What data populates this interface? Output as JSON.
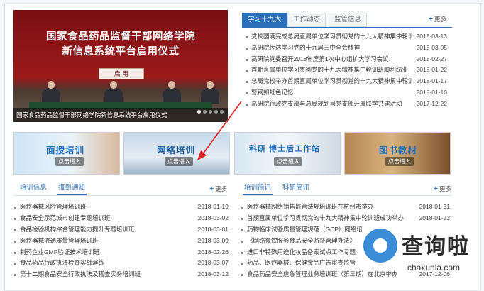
{
  "hero": {
    "title_line1": "国家食品药品监督干部网络学院",
    "title_line2": "新信息系统平台启用仪式",
    "plaque": "启 用",
    "caption": "国家食品药品监督干部网络学院新信息系统平台启用仪式"
  },
  "news": {
    "tabs": [
      "学习十九大",
      "工作动态",
      "监管信息"
    ],
    "more": "更多",
    "items": [
      {
        "title": "党校圆满完成总局直属单位学习贯彻党的十九大精神集中轮训",
        "date": "2018-03-13"
      },
      {
        "title": "高研院传达学习党的十九届三中全会精神",
        "date": "2018-03-05"
      },
      {
        "title": "高研院党委召开2018年度第1次中心组扩大学习会议",
        "date": "2018-02-27"
      },
      {
        "title": "首期直属单位学习贯彻党的十九大精神集中轮训班顺利结业",
        "date": "2018-01-22"
      },
      {
        "title": "总局党校举办首期直属单位学习贯彻党的十九大精神集中轮训",
        "date": "2018-01-17"
      },
      {
        "title": "警钢如虹色记忆",
        "date": "2018-01-10"
      },
      {
        "title": "高研院行政党支部与总局规划司党支部开展联学共建活动",
        "date": "2017-12-22"
      }
    ]
  },
  "banners": [
    {
      "title": "面授培训",
      "enter": "点击进入"
    },
    {
      "title": "网络培训",
      "enter": "点击进入"
    },
    {
      "title": "科研 博士后工作站",
      "enter": "点击进入"
    },
    {
      "title": "图书教材",
      "enter": "点击进入"
    }
  ],
  "training": {
    "tabs": [
      "培训信息",
      "报到通知"
    ],
    "more": "更多",
    "items": [
      {
        "title": "医疗器械风险管理培训班",
        "date": "2018-01-19"
      },
      {
        "title": "食品安全示范城市创建专题培训班",
        "date": "2018-03-02"
      },
      {
        "title": "食品检验机构综合管理能力提升专题培训班",
        "date": "2018-03-01"
      },
      {
        "title": "医疗器械流通质量管理培训班",
        "date": "2018-03-09"
      },
      {
        "title": "制药企业GMP验证技术培训班",
        "date": "2018-02-26"
      },
      {
        "title": "食品药品行政执法检查实战演练",
        "date": "2018-03-07"
      },
      {
        "title": "第十二期食品安全行政执法及稽查实务培训班",
        "date": "2018-03-12"
      }
    ]
  },
  "briefing": {
    "tabs": [
      "培训简讯",
      "科研简讯"
    ],
    "more": "更多",
    "items": [
      {
        "title": "医疗器械网络销售监管法规培训班在杭州市举办",
        "date": "2018-01-31"
      },
      {
        "title": "首期直属单位学习贯彻党的十九大精神集中轮训班成功举办",
        "date": "2018-01-23"
      },
      {
        "title": "药物临床试验质量管理规范（GCP）网络培",
        "date": ""
      },
      {
        "title": "《网络餐饮服务食品安全监督管理办法》",
        "date": ""
      },
      {
        "title": "进口非特殊用途化妆品备案试点工作专题",
        "date": ""
      },
      {
        "title": "药品、医疗器械、保健食品广告审查监管",
        "date": ""
      },
      {
        "title": "食品药品安全应急管理业务培训班（第三期）在北京举办",
        "date": "2017-12-06"
      }
    ]
  },
  "watermark": {
    "text": "查询啦",
    "url": "chaxunla.com"
  }
}
